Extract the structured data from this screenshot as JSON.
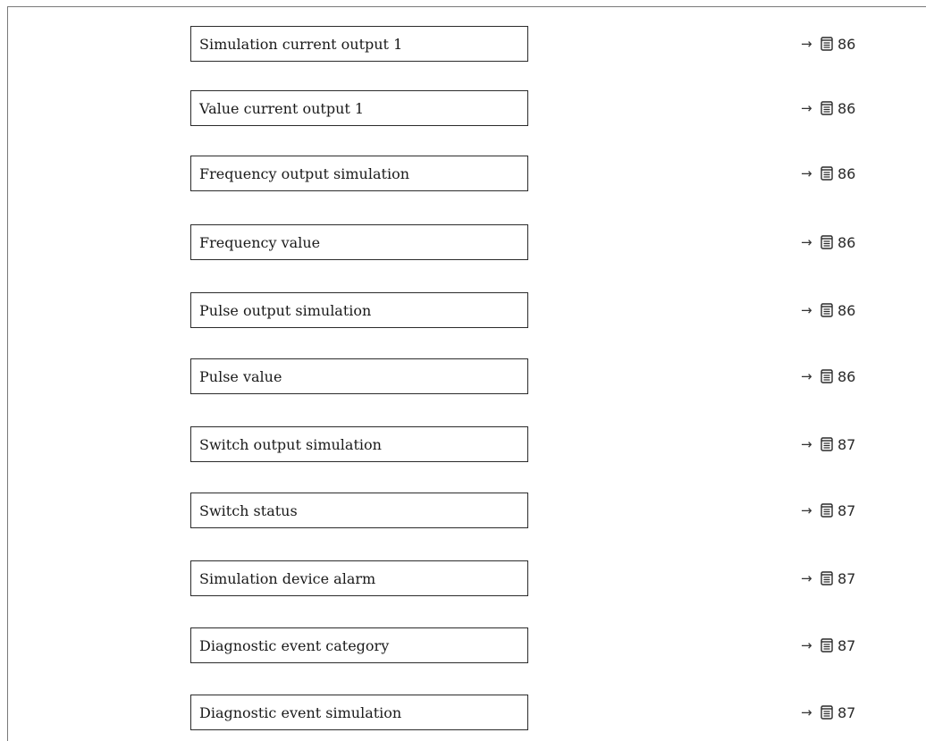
{
  "rows": [
    {
      "label": "Simulation current output 1",
      "arrow": "→",
      "page": "86"
    },
    {
      "label": "Value current output 1",
      "arrow": "→",
      "page": "86"
    },
    {
      "label": "Frequency output simulation",
      "arrow": "→",
      "page": "86"
    },
    {
      "label": "Frequency value",
      "arrow": "→",
      "page": "86"
    },
    {
      "label": "Pulse output simulation",
      "arrow": "→",
      "page": "86"
    },
    {
      "label": "Pulse value",
      "arrow": "→",
      "page": "86"
    },
    {
      "label": "Switch output simulation",
      "arrow": "→",
      "page": "87"
    },
    {
      "label": "Switch status",
      "arrow": "→",
      "page": "87"
    },
    {
      "label": "Simulation device alarm",
      "arrow": "→",
      "page": "87"
    },
    {
      "label": "Diagnostic event category",
      "arrow": "→",
      "page": "87"
    },
    {
      "label": "Diagnostic event simulation",
      "arrow": "→",
      "page": "87"
    }
  ],
  "icons": {
    "arrow": "arrow-right-icon",
    "page_reference": "book-page-icon"
  },
  "colors": {
    "border": "#2b2b2b",
    "frame": "#7a7a7a",
    "text": "#1a1a1a"
  }
}
